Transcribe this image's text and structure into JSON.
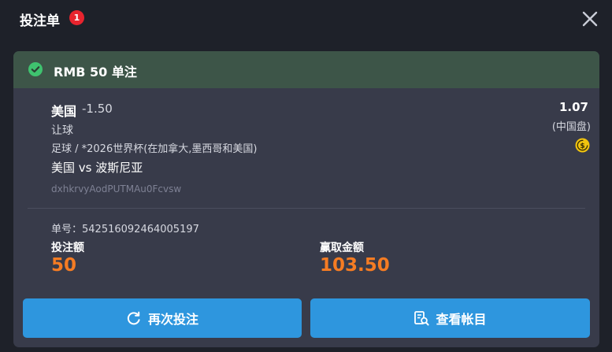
{
  "header": {
    "title": "投注单",
    "badge_count": "1",
    "close_icon": "close-icon"
  },
  "card": {
    "status_icon": "check-circle-icon",
    "status_text": "RMB 50 单注",
    "status_color": "#3d5548",
    "selection": {
      "team": "美国",
      "handicap": "-1.50",
      "bet_type": "让球",
      "league": "足球 / *2026世界杯(在加拿大,墨西哥和美国)",
      "match": "美国 vs 波斯尼亚",
      "code": "dxhkrvyAodPUTMAu0Fcvsw",
      "odds": "1.07",
      "odds_type": "(中国盘)",
      "coin_icon": "coin-icon"
    },
    "order_no": "单号：542516092464005197",
    "stake_label": "投注额",
    "stake_value": "50",
    "win_label": "赢取金额",
    "win_value": "103.50",
    "accent_color": "#f57c23"
  },
  "buttons": {
    "rebet_label": "再次投注",
    "rebet_icon": "refresh-icon",
    "account_label": "查看帐目",
    "account_icon": "ledger-search-icon",
    "button_color": "#2e96de"
  }
}
